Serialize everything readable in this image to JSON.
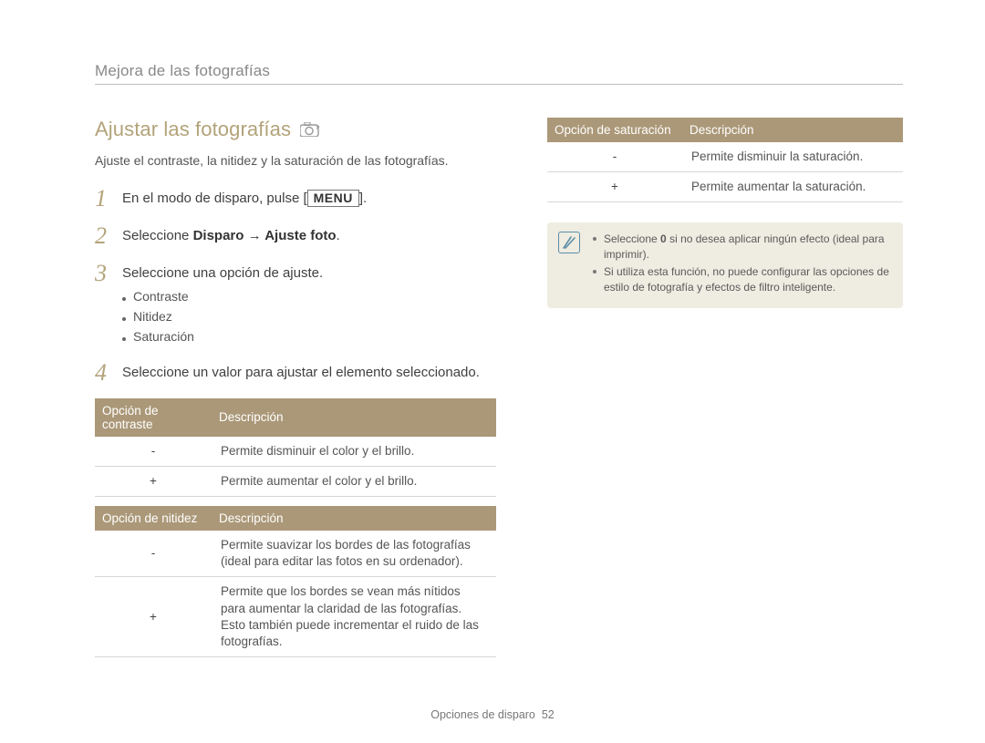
{
  "breadcrumb": "Mejora de las fotografías",
  "section": {
    "title": "Ajustar las fotografías",
    "mode_icon": "camera-p-icon",
    "subtitle": "Ajuste el contraste, la nitidez y la saturación de las fotografías."
  },
  "steps": [
    {
      "num": "1",
      "prefix": "En el modo de disparo, pulse  [",
      "menu_key": "MENU",
      "suffix": "]."
    },
    {
      "num": "2",
      "prefix": "Seleccione ",
      "bold": "Disparo → Ajuste foto",
      "suffix": "."
    },
    {
      "num": "3",
      "prefix": "Seleccione una opción de ajuste.",
      "sublist": [
        "Contraste",
        "Nitidez",
        "Saturación"
      ]
    },
    {
      "num": "4",
      "prefix": "Seleccione un valor para ajustar el elemento seleccionado."
    }
  ],
  "tables": {
    "contrast": {
      "headers": [
        "Opción de contraste",
        "Descripción"
      ],
      "rows": [
        {
          "sym": "-",
          "desc": "Permite disminuir el color y el brillo."
        },
        {
          "sym": "+",
          "desc": "Permite aumentar el color y el brillo."
        }
      ]
    },
    "sharpness": {
      "headers": [
        "Opción de nitidez",
        "Descripción"
      ],
      "rows": [
        {
          "sym": "-",
          "desc": "Permite suavizar los bordes de las fotografías (ideal para editar las fotos en su ordenador)."
        },
        {
          "sym": "+",
          "desc": "Permite que los bordes se vean más nítidos para aumentar la claridad de las fotografías. Esto también puede incrementar el ruido de las fotografías."
        }
      ]
    },
    "saturation": {
      "headers": [
        "Opción de saturación",
        "Descripción"
      ],
      "rows": [
        {
          "sym": "-",
          "desc": "Permite disminuir la saturación."
        },
        {
          "sym": "+",
          "desc": "Permite aumentar la saturación."
        }
      ]
    }
  },
  "notes": [
    {
      "pre": "Seleccione ",
      "strong": "0",
      "post": " si no desea aplicar ningún efecto (ideal para imprimir)."
    },
    {
      "text": "Si utiliza esta función, no puede configurar las opciones de estilo de fotografía y efectos de filtro inteligente."
    }
  ],
  "footer": {
    "section": "Opciones de disparo",
    "page": "52"
  }
}
